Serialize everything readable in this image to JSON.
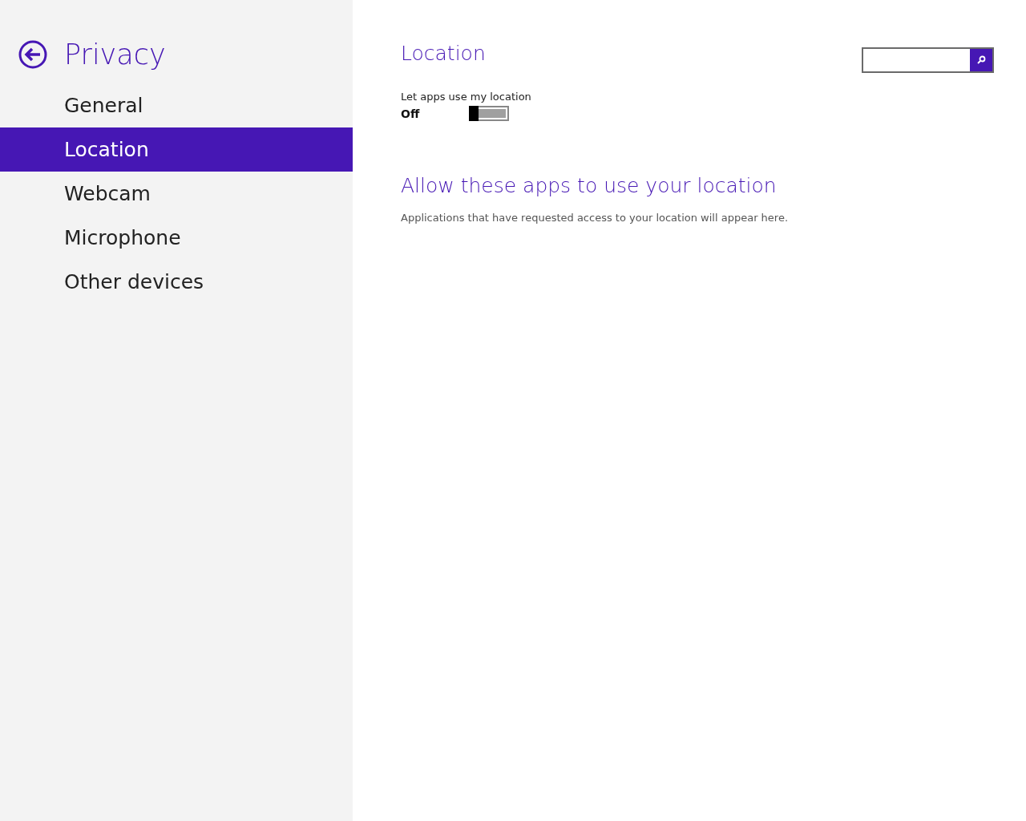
{
  "sidebar": {
    "title": "Privacy",
    "items": [
      {
        "label": "General",
        "selected": false
      },
      {
        "label": "Location",
        "selected": true
      },
      {
        "label": "Webcam",
        "selected": false
      },
      {
        "label": "Microphone",
        "selected": false
      },
      {
        "label": "Other devices",
        "selected": false
      }
    ]
  },
  "content": {
    "heading": "Location",
    "setting": {
      "label": "Let apps use my location",
      "state_text": "Off",
      "on": false
    },
    "apps_heading": "Allow these apps to use your location",
    "apps_note": "Applications that have requested access to your location will appear here."
  }
}
